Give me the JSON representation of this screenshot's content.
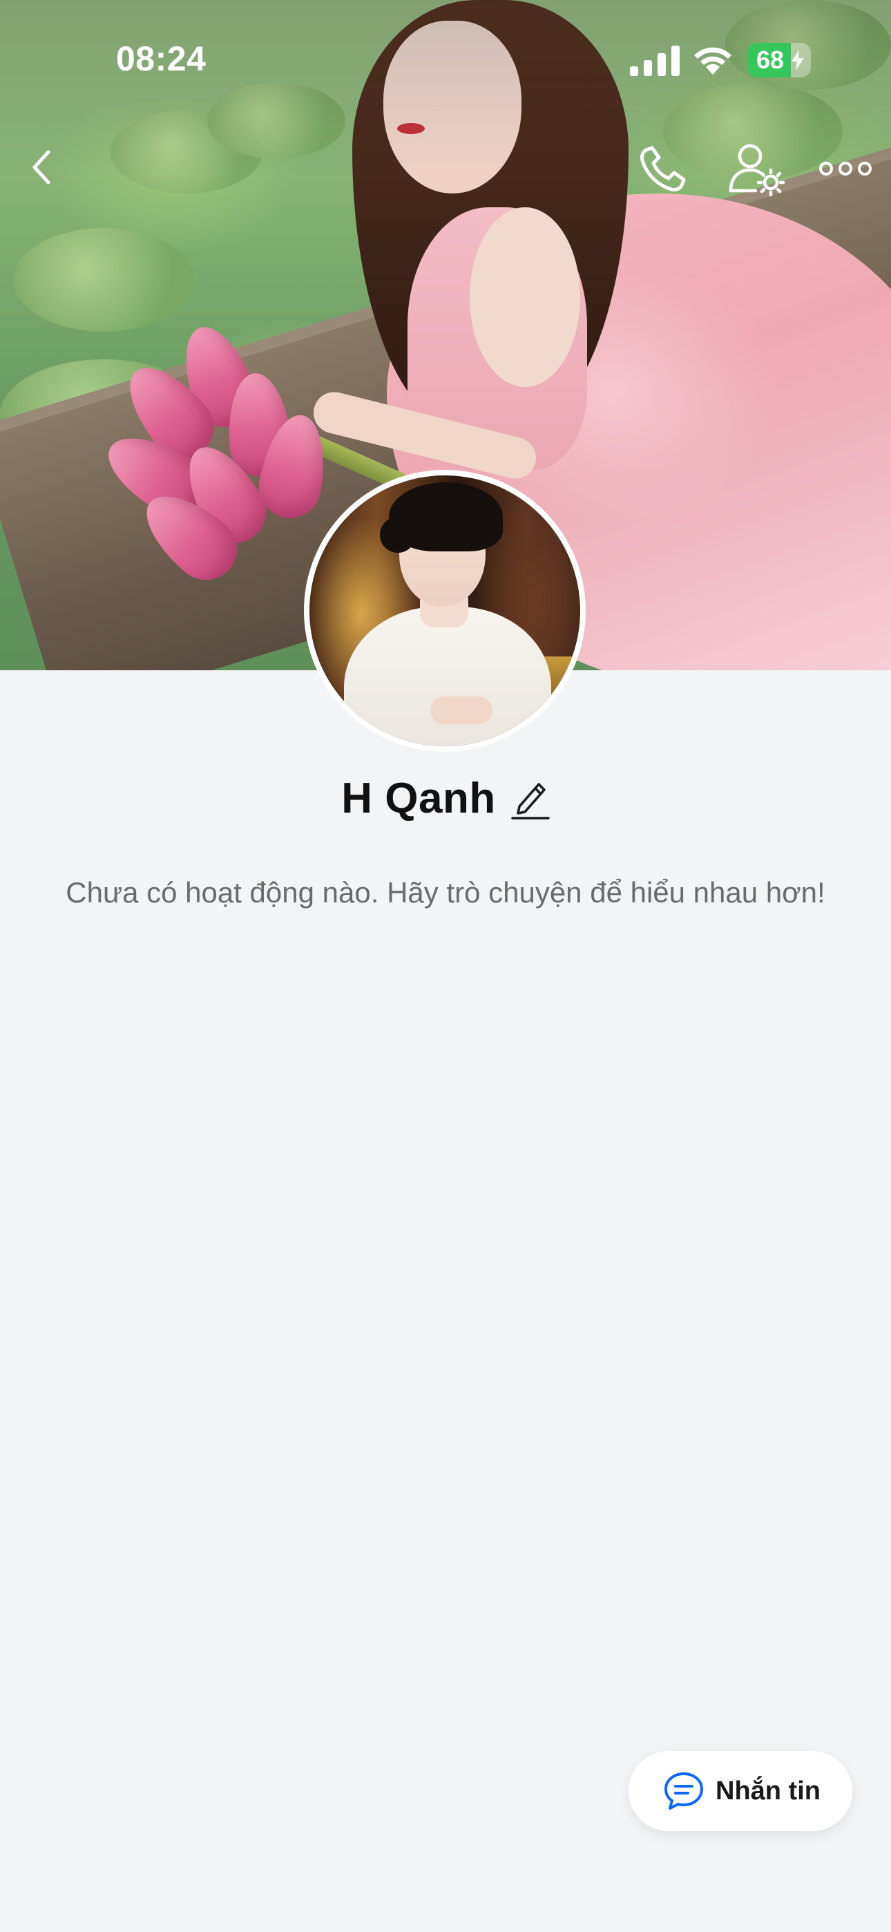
{
  "status_bar": {
    "time": "08:24",
    "battery_level": "68",
    "battery_charging": true,
    "icons": [
      "cellular-signal-icon",
      "wifi-icon",
      "battery-icon",
      "charging-bolt-icon"
    ]
  },
  "top_nav": {
    "icons": [
      "chevron-left-icon",
      "phone-icon",
      "user-settings-icon",
      "more-dots-icon"
    ]
  },
  "profile": {
    "name": "H Qanh",
    "edit_icon": "pencil-icon",
    "empty_activity_text": "Chưa có hoạt động nào. Hãy trò chuyện để hiểu nhau hơn!"
  },
  "actions": {
    "message_label": "Nhắn tin",
    "message_icon": "chat-bubble-icon"
  },
  "colors": {
    "background": "#f3f4f6",
    "battery_green": "#34c759",
    "chat_icon_blue": "#0a68ff",
    "text_primary": "#111111",
    "text_secondary": "#6b6b6b"
  }
}
